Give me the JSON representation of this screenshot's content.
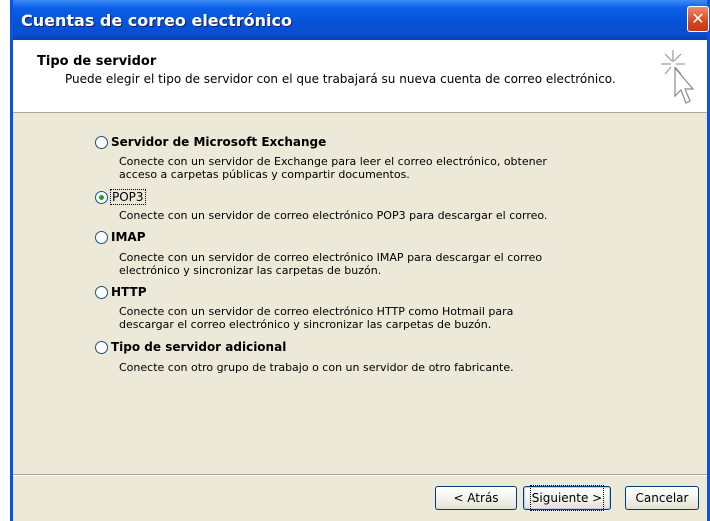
{
  "window": {
    "title": "Cuentas de correo electrónico",
    "close_glyph": "✕",
    "accent_color": "#0A54E4",
    "close_color": "#D6471F"
  },
  "header": {
    "title": "Tipo de servidor",
    "description": "Puede elegir el tipo de servidor con el que trabajará su nueva cuenta de correo electrónico.",
    "icon": "wizard-cursor-sparkle-icon"
  },
  "options": [
    {
      "label": "Servidor de Microsoft Exchange",
      "checked": false,
      "description": "Conecte con un servidor de Exchange para leer el correo electrónico, obtener\nacceso a carpetas públicas y compartir documentos."
    },
    {
      "label": "POP3",
      "checked": true,
      "description": "Conecte con un servidor de correo electrónico POP3 para descargar el correo."
    },
    {
      "label": "IMAP",
      "checked": false,
      "description": "Conecte con un servidor de correo electrónico IMAP para descargar el correo\nelectrónico y sincronizar las carpetas de buzón."
    },
    {
      "label": "HTTP",
      "checked": false,
      "description": "Conecte con un servidor de correo electrónico HTTP como Hotmail para\ndescargar el correo electrónico y sincronizar las carpetas de buzón."
    },
    {
      "label": "Tipo de servidor adicional",
      "checked": false,
      "description": "Conecte con otro grupo de trabajo o con un servidor de otro fabricante."
    }
  ],
  "buttons": {
    "back": "< Atrás",
    "next": "Siguiente >",
    "cancel": "Cancelar"
  }
}
